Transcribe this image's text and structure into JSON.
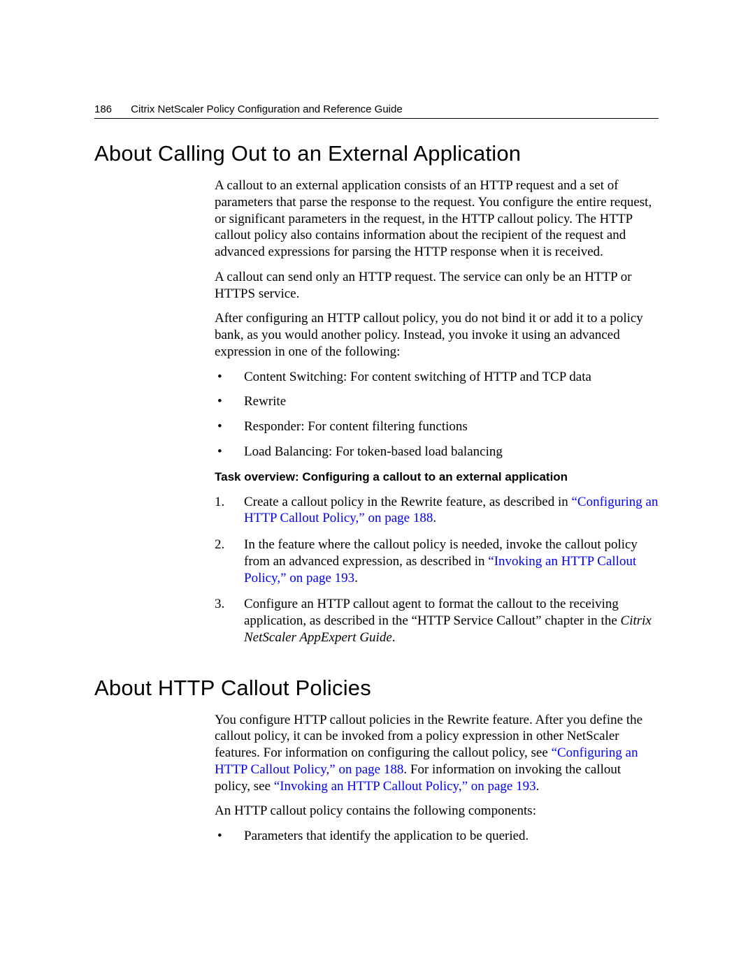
{
  "header": {
    "page_number": "186",
    "title": "Citrix NetScaler Policy Configuration and Reference Guide"
  },
  "section1": {
    "heading": "About Calling Out to an External Application",
    "p1": "A callout to an external application consists of an HTTP request and a set of parameters that parse the response to the request. You configure the entire request, or significant parameters in the request, in the HTTP callout policy. The HTTP callout policy also contains information about the recipient of the request and advanced expressions for parsing the HTTP response when it is received.",
    "p2": "A callout can send only an HTTP request. The service can only be an HTTP or HTTPS service.",
    "p3": "After configuring an HTTP callout policy, you do not bind it or add it to a policy bank, as you would another policy. Instead, you invoke it using an advanced expression in one of the following:",
    "bullets": [
      "Content Switching: For content switching of HTTP and TCP data",
      "Rewrite",
      "Responder: For content filtering functions",
      "Load Balancing: For token-based load balancing"
    ],
    "task_heading": "Task overview: Configuring a callout to an external application",
    "step1_pre": "Create a callout policy in the Rewrite feature, as described in ",
    "step1_link": "“Configuring an HTTP Callout Policy,” on page 188",
    "step1_post": ".",
    "step2_pre": "In the feature where the callout policy is needed, invoke the callout policy from an advanced expression, as described in ",
    "step2_link": "“Invoking an HTTP Callout Policy,” on page 193",
    "step2_post": ".",
    "step3_pre": "Configure an HTTP callout agent to format the callout to the receiving application, as described in the “HTTP Service Callout” chapter in the ",
    "step3_italic": "Citrix NetScaler AppExpert Guide",
    "step3_post": "."
  },
  "section2": {
    "heading": "About HTTP Callout Policies",
    "p1_a": "You configure HTTP callout policies in the Rewrite feature. After you define the callout policy, it can be invoked from a policy expression in other NetScaler features. For information on configuring the callout policy, see ",
    "p1_link1": "“Configuring an HTTP Callout Policy,” on page 188",
    "p1_b": ". For information on invoking the callout policy, see ",
    "p1_link2": "“Invoking an HTTP Callout Policy,” on page 193",
    "p1_c": ".",
    "p2": "An HTTP callout policy contains the following components:",
    "bullets": [
      "Parameters that identify the application to be queried."
    ]
  }
}
